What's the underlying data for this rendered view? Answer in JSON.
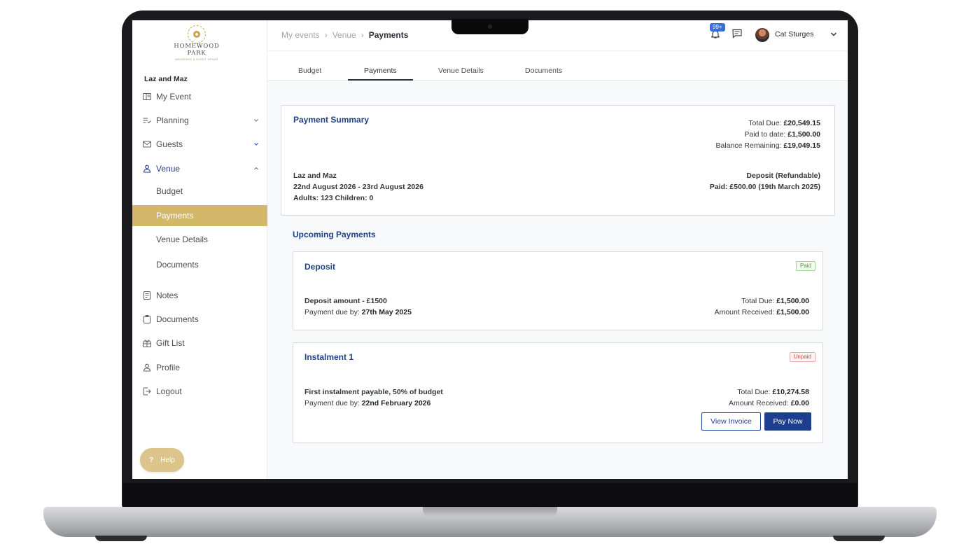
{
  "logo": {
    "name_line1": "HOMEWOOD",
    "name_line2": "PARK",
    "tagline": "WEDDINGS & EVENT VENUE"
  },
  "sidebar": {
    "event_name": "Laz and Maz",
    "items": [
      {
        "label": "My Event",
        "icon": "calendar-panel-icon"
      },
      {
        "label": "Planning",
        "icon": "checklist-icon",
        "chevron": "down"
      },
      {
        "label": "Guests",
        "icon": "envelope-icon",
        "chevron": "down"
      },
      {
        "label": "Venue",
        "icon": "person-icon",
        "chevron": "up"
      }
    ],
    "venue_sub": [
      {
        "label": "Budget"
      },
      {
        "label": "Payments"
      },
      {
        "label": "Venue Details"
      },
      {
        "label": "Documents"
      }
    ],
    "bottom_items": [
      {
        "label": "Notes",
        "icon": "notes-icon"
      },
      {
        "label": "Documents",
        "icon": "clipboard-icon"
      },
      {
        "label": "Gift List",
        "icon": "gift-icon"
      },
      {
        "label": "Profile",
        "icon": "person-icon"
      },
      {
        "label": "Logout",
        "icon": "logout-icon"
      }
    ],
    "help": {
      "label": "Help",
      "icon": "question-icon"
    }
  },
  "header": {
    "breadcrumbs": [
      "My events",
      "Venue",
      "Payments"
    ],
    "notification_badge": "99+",
    "user_name": "Cat Sturges"
  },
  "tabs": [
    {
      "label": "Budget"
    },
    {
      "label": "Payments",
      "active": true
    },
    {
      "label": "Venue Details"
    },
    {
      "label": "Documents"
    }
  ],
  "summary": {
    "title": "Payment Summary",
    "total_due_label": "Total Due:",
    "total_due": "£20,549.15",
    "paid_label": "Paid to date:",
    "paid": "£1,500.00",
    "balance_label": "Balance Remaining:",
    "balance": "£19,049.15",
    "couple": "Laz and Maz",
    "dates": "22nd August 2026 - 23rd August 2026",
    "guests": "Adults: 123 Children: 0",
    "deposit_title": "Deposit (Refundable)",
    "deposit_paid": "Paid: £500.00 (19th March 2025)"
  },
  "upcoming_title": "Upcoming Payments",
  "payments": [
    {
      "title": "Deposit",
      "status": "Paid",
      "description": "Deposit amount - £1500",
      "due_label": "Payment due by:",
      "due_date": "27th May 2025",
      "total_due_label": "Total Due:",
      "total_due": "£1,500.00",
      "received_label": "Amount Received:",
      "received": "£1,500.00"
    },
    {
      "title": "Instalment 1",
      "status": "Unpaid",
      "description": "First instalment payable, 50% of budget",
      "due_label": "Payment due by:",
      "due_date": "22nd February 2026",
      "total_due_label": "Total Due:",
      "total_due": "£10,274.58",
      "received_label": "Amount Received:",
      "received": "£0.00",
      "view_invoice_label": "View Invoice",
      "pay_now_label": "Pay Now"
    }
  ],
  "colors": {
    "accent_gold": "#d4b86a",
    "primary_navy": "#1d3d8f",
    "paid_green": "#4c9c35",
    "unpaid_red": "#cc4b4b"
  }
}
